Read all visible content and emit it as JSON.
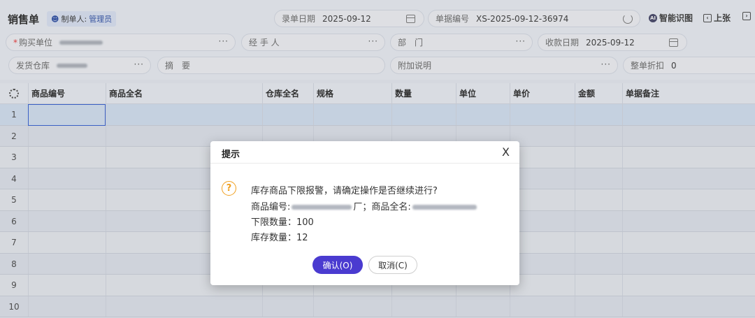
{
  "header": {
    "title": "销售单",
    "maker_label": "制单人:",
    "maker_name": "管理员",
    "entry_date_label": "录单日期",
    "entry_date_value": "2025-09-12",
    "doc_no_label": "单据编号",
    "doc_no_value": "XS-2025-09-12-36974",
    "ai_label": "智能识图",
    "prev_label": "上张",
    "next_icon": "chevron-right-icon"
  },
  "form": {
    "buyer_label": "购买单位",
    "handler_label": "经 手 人",
    "dept_label": "部　门",
    "collect_date_label": "收款日期",
    "collect_date_value": "2025-09-12",
    "warehouse_label": "发货仓库",
    "summary_label": "摘　要",
    "remark_label": "附加说明",
    "discount_label": "整单折扣",
    "discount_value": "0",
    "dots": "···"
  },
  "grid": {
    "columns": [
      "商品编号",
      "商品全名",
      "仓库全名",
      "规格",
      "数量",
      "单位",
      "单价",
      "金额",
      "单据备注"
    ],
    "rows": [
      "1",
      "2",
      "3",
      "4",
      "5",
      "6",
      "7",
      "8",
      "9",
      "10"
    ]
  },
  "dialog": {
    "title": "提示",
    "close": "X",
    "line1": "库存商品下限报警，请确定操作是否继续进行?",
    "code_label": "商品编号:",
    "code_suffix": "厂",
    "name_label": "；商品全名:",
    "lower_limit": "下限数量：100",
    "stock_qty": "库存数量：12",
    "confirm": "确认(O)",
    "cancel": "取消(C)"
  },
  "colors": {
    "accent": "#4a3bd0",
    "warning": "#f0a020",
    "selection": "#2e5bd6"
  }
}
